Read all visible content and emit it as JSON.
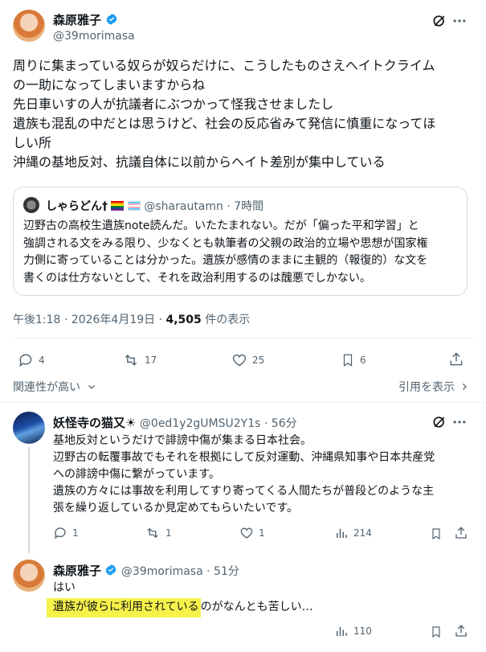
{
  "main_post": {
    "author_name": "森原雅子",
    "author_handle": "@39morimasa",
    "body_lines": [
      "周りに集まっている奴らが奴らだけに、こうしたものさえヘイトクライム",
      "の一助になってしまいますからね",
      "先日車いすの人が抗議者にぶつかって怪我させましたし",
      "遺族も混乱の中だとは思うけど、社会の反応省みて発信に慎重になってほ",
      "しい所",
      "沖縄の基地反対、抗議自体に以前からヘイト差別が集中している"
    ],
    "quote": {
      "name": "しゃらどん†",
      "handle": "@sharautamn",
      "time": "7時間",
      "lines": [
        "辺野古の高校生遺族note読んだ。いたたまれない。だが「偏った平和学習」と",
        "強調される文をみる限り、少なくとも執筆者の父親の政治的立場や思想が国家権",
        "力側に寄っていることは分かった。遺族が感情のままに主観的（報復的）な文を",
        "書くのは仕方ないとして、それを政治利用するのは醜悪でしかない。"
      ]
    },
    "meta": {
      "time_date": "午後1:18 · 2026年4月19日 · ",
      "views": "4,505",
      "views_label": " 件の表示"
    },
    "stats": {
      "replies": "4",
      "reposts": "17",
      "likes": "25",
      "bookmarks": "6"
    }
  },
  "sort": {
    "left": "関連性が高い",
    "right": "引用を表示"
  },
  "reply1": {
    "author_name": "妖怪寺の猫又☀",
    "author_handle": "@0ed1y2gUMSU2Y1s",
    "time": "56分",
    "lines": [
      "基地反対というだけで誹謗中傷が集まる日本社会。",
      "辺野古の転覆事故でもそれを根拠にして反対運動、沖縄県知事や日本共産党",
      "への誹謗中傷に繋がっています。",
      "遺族の方々には事故を利用してすり寄ってくる人間たちが普段どのような主",
      "張を繰り返しているか見定めてもらいたいです。"
    ],
    "stats": {
      "replies": "1",
      "reposts": "1",
      "likes": "1",
      "views": "214"
    }
  },
  "reply2": {
    "author_name": "森原雅子",
    "author_handle": "@39morimasa",
    "time": "51分",
    "line1": "はい",
    "line2_highlight": "遺族が彼らに利用されている",
    "line2_rest": "のがなんとも苦しい…",
    "stats": {
      "views": "110"
    }
  },
  "colors": {
    "accent": "#1d9bf0",
    "muted": "#536471",
    "highlight": "#f7f24a"
  }
}
